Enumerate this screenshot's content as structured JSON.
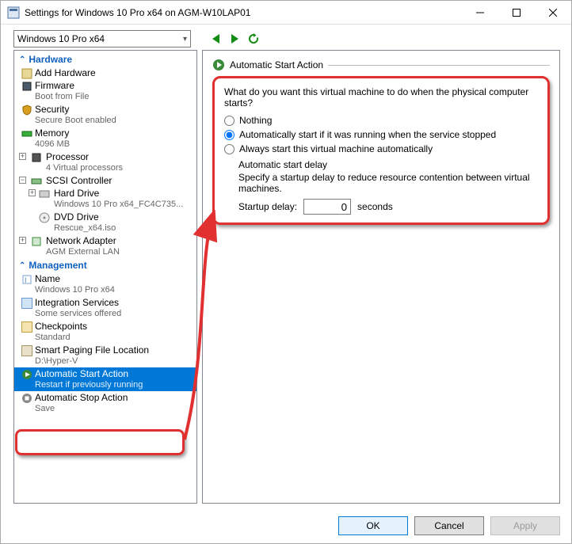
{
  "window": {
    "title": "Settings for Windows 10 Pro x64 on AGM-W10LAP01"
  },
  "toolbar": {
    "vm_selector": "Windows 10 Pro x64"
  },
  "tree": {
    "hardware_header": "Hardware",
    "management_header": "Management",
    "add_hardware": "Add Hardware",
    "firmware": {
      "label": "Firmware",
      "sub": "Boot from File"
    },
    "security": {
      "label": "Security",
      "sub": "Secure Boot enabled"
    },
    "memory": {
      "label": "Memory",
      "sub": "4096 MB"
    },
    "processor": {
      "label": "Processor",
      "sub": "4 Virtual processors"
    },
    "scsi": {
      "label": "SCSI Controller"
    },
    "hard_drive": {
      "label": "Hard Drive",
      "sub": "Windows 10 Pro x64_FC4C735..."
    },
    "dvd": {
      "label": "DVD Drive",
      "sub": "Rescue_x64.iso"
    },
    "netadapter": {
      "label": "Network Adapter",
      "sub": "AGM External LAN"
    },
    "name": {
      "label": "Name",
      "sub": "Windows 10 Pro x64"
    },
    "integration": {
      "label": "Integration Services",
      "sub": "Some services offered"
    },
    "checkpoints": {
      "label": "Checkpoints",
      "sub": "Standard"
    },
    "paging": {
      "label": "Smart Paging File Location",
      "sub": "D:\\Hyper-V"
    },
    "autostart": {
      "label": "Automatic Start Action",
      "sub": "Restart if previously running"
    },
    "autostop": {
      "label": "Automatic Stop Action",
      "sub": "Save"
    }
  },
  "content": {
    "group_title": "Automatic Start Action",
    "question": "What do you want this virtual machine to do when the physical computer starts?",
    "opt_nothing": "Nothing",
    "opt_auto_if_running": "Automatically start if it was running when the service stopped",
    "opt_always": "Always start this virtual machine automatically",
    "selected_option": "auto_if_running",
    "delay_title": "Automatic start delay",
    "delay_desc": "Specify a startup delay to reduce resource contention between virtual machines.",
    "delay_label": "Startup delay:",
    "delay_value": "0",
    "delay_unit": "seconds"
  },
  "buttons": {
    "ok": "OK",
    "cancel": "Cancel",
    "apply": "Apply"
  }
}
